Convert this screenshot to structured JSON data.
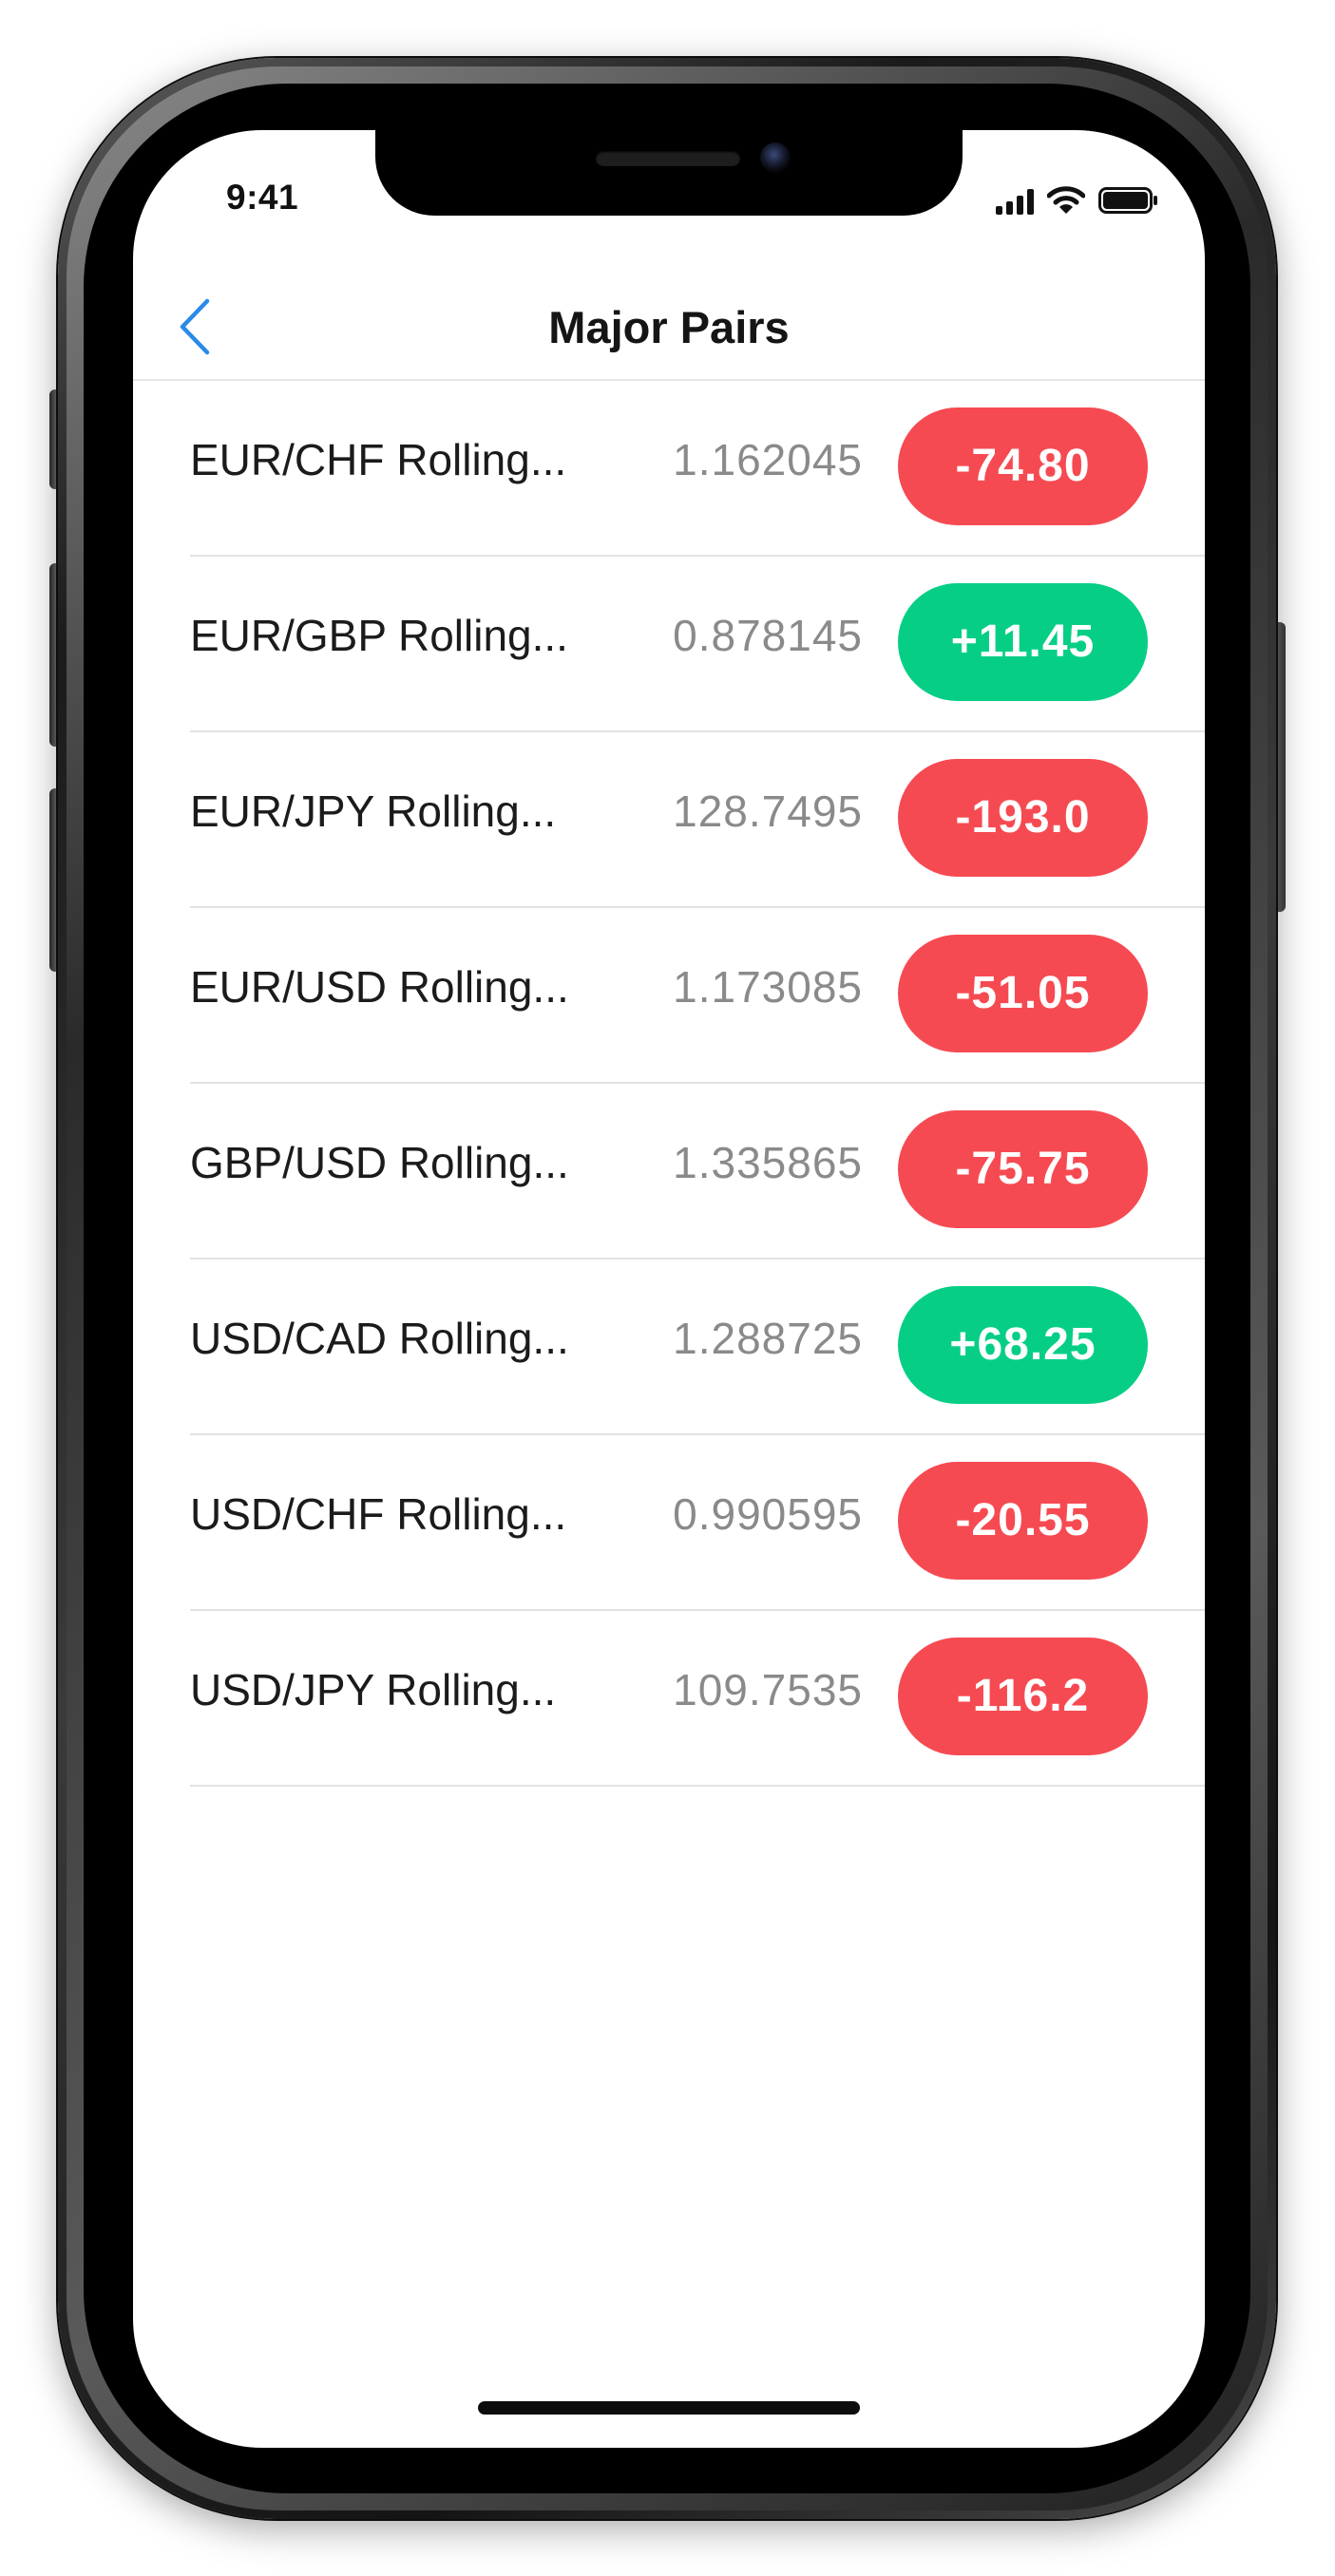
{
  "status_bar": {
    "time": "9:41",
    "icons": [
      "signal-icon",
      "wifi-icon",
      "battery-icon"
    ]
  },
  "nav": {
    "back_icon": "chevron-left-icon",
    "title": "Major Pairs"
  },
  "colors": {
    "accent": "#2a8ae8",
    "negative": "#f64a52",
    "positive": "#06cf85",
    "price_text": "#8a8a8a"
  },
  "pairs": [
    {
      "name": "EUR/CHF Rolling...",
      "price": "1.162045",
      "change": "-74.80",
      "direction": "down"
    },
    {
      "name": "EUR/GBP Rolling...",
      "price": "0.878145",
      "change": "+11.45",
      "direction": "up"
    },
    {
      "name": "EUR/JPY Rolling...",
      "price": "128.7495",
      "change": "-193.0",
      "direction": "down"
    },
    {
      "name": "EUR/USD Rolling...",
      "price": "1.173085",
      "change": "-51.05",
      "direction": "down"
    },
    {
      "name": "GBP/USD Rolling...",
      "price": "1.335865",
      "change": "-75.75",
      "direction": "down"
    },
    {
      "name": "USD/CAD Rolling...",
      "price": "1.288725",
      "change": "+68.25",
      "direction": "up"
    },
    {
      "name": "USD/CHF Rolling...",
      "price": "0.990595",
      "change": "-20.55",
      "direction": "down"
    },
    {
      "name": "USD/JPY Rolling...",
      "price": "109.7535",
      "change": "-116.2",
      "direction": "down"
    }
  ]
}
